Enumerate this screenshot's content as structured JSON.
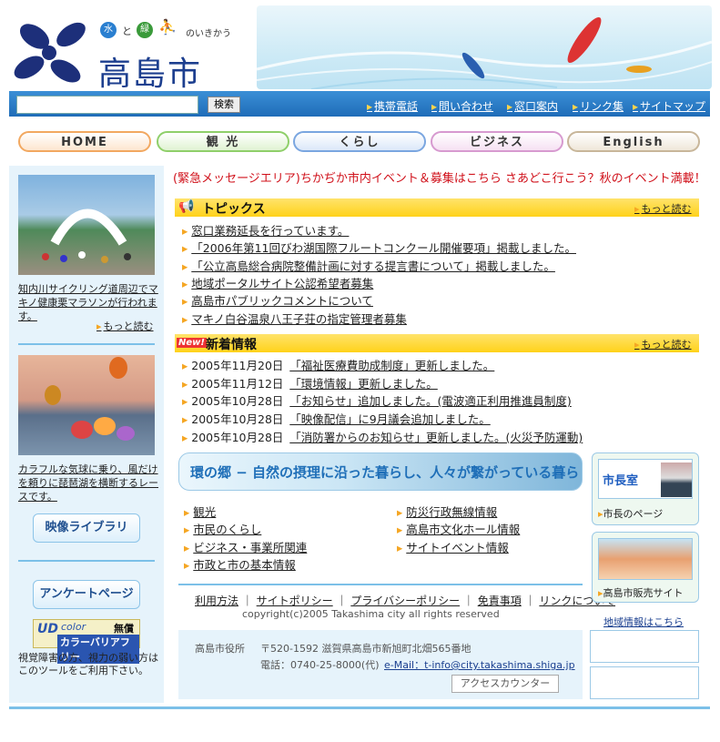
{
  "header": {
    "tagline": "のいきかう",
    "tag_water": "水",
    "tag_to": "と",
    "tag_green": "緑",
    "site_name": "高島市"
  },
  "search": {
    "value": "",
    "button_label": "検索"
  },
  "top_links": [
    "携帯電話",
    "問い合わせ",
    "窓口案内",
    "リンク集",
    "サイトマップ"
  ],
  "nav": {
    "items": [
      {
        "label": "HOME",
        "color": "#f2a860"
      },
      {
        "label": "観 光",
        "color": "#8fcf6a"
      },
      {
        "label": "くらし",
        "color": "#7aa6e0"
      },
      {
        "label": "ビジネス",
        "color": "#d79ad0"
      },
      {
        "label": "English",
        "color": "#c8b69a"
      }
    ]
  },
  "left": {
    "story1": "知内川サイクリング道周辺でマキノ健康栗マラソンが行われます。",
    "more1": "もっと読む",
    "story2": "カラフルな気球に乗り、風だけを頼りに琵琶湖を横断するレースです。",
    "video_library": "映像ライブラリ",
    "survey_page": "アンケートページ",
    "ud_brand": "color",
    "ud_free": "無償",
    "ud_name": "カラーバリアフリー",
    "ud_note": "視覚障害の方、視力の弱い方はこのツールをご利用下さい。"
  },
  "emergency": "(緊急メッセージエリア)ちかぢか市内イベント＆募集はこちら さあどこ行こう？秋のイベント満載！",
  "topics": {
    "title": "トピックス",
    "more": "もっと読む",
    "items": [
      "窓口業務延長を行っています。",
      "「2006年第11回びわ湖国際フルートコンクール開催要項」掲載しました。",
      "「公立高島総合病院整備計画に対する提言書について」掲載しました。",
      "地域ポータルサイト公認希望者募集",
      "高島市パブリックコメントについて",
      "マキノ白谷温泉八王子荘の指定管理者募集"
    ]
  },
  "news": {
    "badge": "New!",
    "title": "新着情報",
    "more": "もっと読む",
    "items": [
      {
        "date": "2005年11月20日",
        "text": "「福祉医療費助成制度」更新しました。"
      },
      {
        "date": "2005年11月12日",
        "text": "「環境情報」更新しました。"
      },
      {
        "date": "2005年10月28日",
        "text": "「お知らせ」追加しました。(電波適正利用推進員制度)"
      },
      {
        "date": "2005年10月28日",
        "text": "「映像配信」に9月議会追加しました。"
      },
      {
        "date": "2005年10月28日",
        "text": "「消防署からのお知らせ」更新しました。(火災予防運動)"
      }
    ]
  },
  "banner": "環の郷 − 自然の摂理に沿った暮らし、人々が繋がっている暮らし。",
  "links_left": [
    "観光",
    "市民のくらし",
    "ビジネス・事業所関連",
    "市政と市の基本情報"
  ],
  "links_right": [
    "防災行政無線情報",
    "高島市文化ホール情報",
    "サイトイベント情報"
  ],
  "footer": {
    "links": [
      "利用方法",
      "サイトポリシー",
      "プライバシーポリシー",
      "免責事項",
      "リンクについて"
    ],
    "copyright": "copyright(c)2005 Takashima city all rights reserved",
    "office": "高島市役所",
    "address": "〒520-1592 滋賀県高島市新旭町北畑565番地",
    "phone": "電話：0740-25-8000(代)",
    "email": "e-Mail：t-info@city.takashima.shiga.jp",
    "counter": "アクセスカウンター"
  },
  "right": {
    "mayor_label": "市長室",
    "mayor_link": "市長のページ",
    "shop_link": "高島市販売サイト",
    "regional": "地域情報はこちら"
  }
}
